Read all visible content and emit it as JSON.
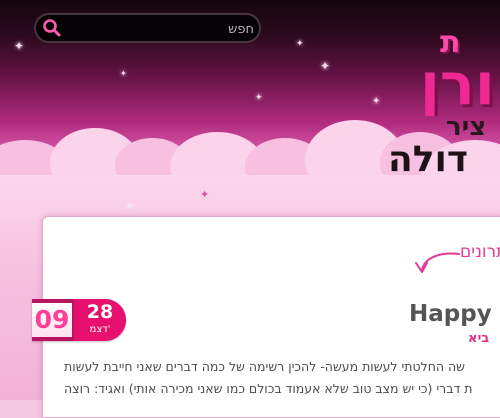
{
  "header": {
    "search": {
      "placeholder": "חפש",
      "icon": "search-icon"
    },
    "logo": {
      "line1": "ת",
      "line2": "ורן",
      "line3": "ציר",
      "line4": "דולה"
    }
  },
  "main": {
    "section_title": "תרונים",
    "post": {
      "title": "Happy N",
      "author": "ביא",
      "excerpt_lines": [
        "שה החלטתי לעשות מעשה- להכין רשימה של כמה דברים שאני חייבת לעשות",
        "ת דברי (כי יש מצב טוב שלא אעמוד בכולם כמו שאני מכירה אותי) ואגיד: רוצה"
      ],
      "date": {
        "day": "28",
        "month": "דצמ'",
        "year": "09"
      }
    }
  },
  "colors": {
    "accent": "#e7106f",
    "accent_dark": "#b8145f",
    "title_pink": "#e33b97",
    "search_bg": "#050205"
  }
}
